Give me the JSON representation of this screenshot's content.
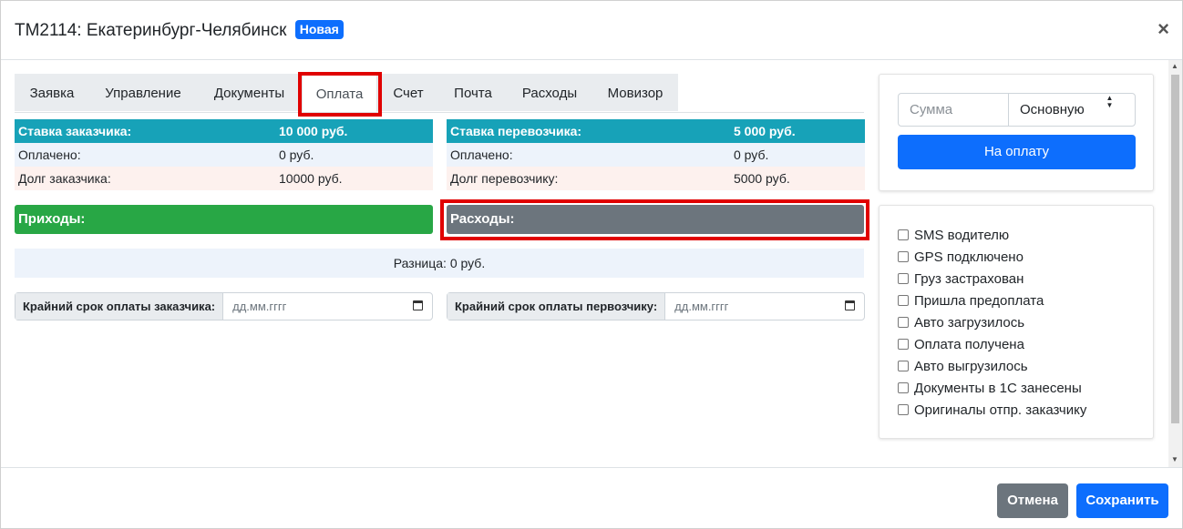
{
  "header": {
    "title": "ТМ2114: Екатеринбург-Челябинск",
    "badge": "Новая",
    "close": "×"
  },
  "tabs": [
    {
      "label": "Заявка"
    },
    {
      "label": "Управление"
    },
    {
      "label": "Документы"
    },
    {
      "label": "Оплата",
      "active": true
    },
    {
      "label": "Счет"
    },
    {
      "label": "Почта"
    },
    {
      "label": "Расходы"
    },
    {
      "label": "Мовизор"
    }
  ],
  "customer": {
    "rate_label": "Ставка заказчика:",
    "rate_value": "10 000 руб.",
    "paid_label": "Оплачено:",
    "paid_value": "0 руб.",
    "debt_label": "Долг заказчика:",
    "debt_value": "10000 руб."
  },
  "carrier": {
    "rate_label": "Ставка перевозчика:",
    "rate_value": "5 000 руб.",
    "paid_label": "Оплачено:",
    "paid_value": "0 руб.",
    "debt_label": "Долг перевозчику:",
    "debt_value": "5000 руб."
  },
  "income_label": "Приходы:",
  "expense_label": "Расходы:",
  "difference": "Разница: 0 руб.",
  "deadline_customer": {
    "label": "Крайний срок оплаты заказчика:",
    "placeholder": "дд.мм.гггг"
  },
  "deadline_carrier": {
    "label": "Крайний срок оплаты первозчику:",
    "placeholder": "дд.мм.гггг"
  },
  "payment": {
    "amount_placeholder": "Сумма",
    "type_selected": "Основную",
    "submit": "На оплату"
  },
  "checklist": [
    "SMS водителю",
    "GPS подключено",
    "Груз застрахован",
    "Пришла предоплата",
    "Авто загрузилось",
    "Оплата получена",
    "Авто выгрузилось",
    "Документы в 1С занесены",
    "Оригиналы отпр. заказчику"
  ],
  "footer": {
    "cancel": "Отмена",
    "save": "Сохранить"
  },
  "colors": {
    "primary": "#0d6efd",
    "info": "#17a2b8",
    "success": "#28a745",
    "secondary": "#6c757d",
    "highlight": "#e00000"
  }
}
